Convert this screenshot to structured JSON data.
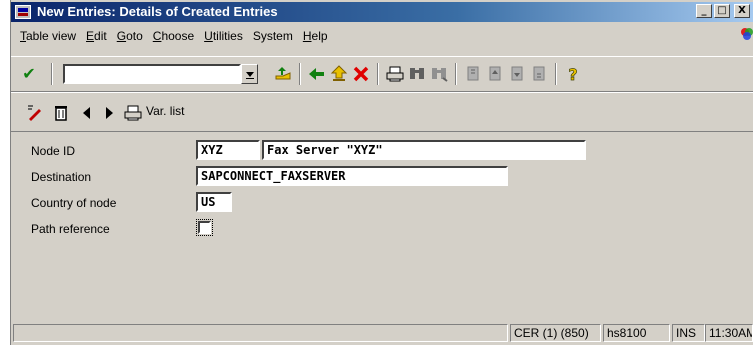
{
  "window": {
    "title": "New Entries: Details of Created Entries",
    "app_icon_text": "MCP",
    "buttons": {
      "minimize": "_",
      "restore": "□",
      "close": "X"
    }
  },
  "menubar": {
    "items": [
      {
        "label": "Table view",
        "ul": "T",
        "rest": "able view"
      },
      {
        "label": "Edit",
        "ul": "E",
        "rest": "dit"
      },
      {
        "label": "Goto",
        "ul": "G",
        "rest": "oto"
      },
      {
        "label": "Choose",
        "ul": "C",
        "rest": "hoose"
      },
      {
        "label": "Utilities",
        "ul": "U",
        "rest": "tilities"
      },
      {
        "label": "System",
        "ul": "",
        "rest": "System"
      },
      {
        "label": "Help",
        "ul": "H",
        "rest": "elp"
      }
    ]
  },
  "toolbar": {
    "command_field_value": "",
    "icons": [
      "enter-check",
      "save",
      "back",
      "exit",
      "cancel",
      "print",
      "find",
      "find-next",
      "first-page",
      "prev-page",
      "next-page",
      "last-page",
      "help"
    ]
  },
  "app_toolbar": {
    "var_list_label": "Var. list"
  },
  "form": {
    "node_id": {
      "label": "Node ID",
      "value": "XYZ",
      "description": "Fax Server \"XYZ\""
    },
    "destination": {
      "label": "Destination",
      "value": "SAPCONNECT_FAXSERVER"
    },
    "country": {
      "label": "Country of node",
      "value": "US"
    },
    "path_reference": {
      "label": "Path reference",
      "checked": false
    }
  },
  "statusbar": {
    "system": "CER (1) (850)",
    "server": "hs8100",
    "mode": "INS",
    "time": "11:30AM"
  }
}
